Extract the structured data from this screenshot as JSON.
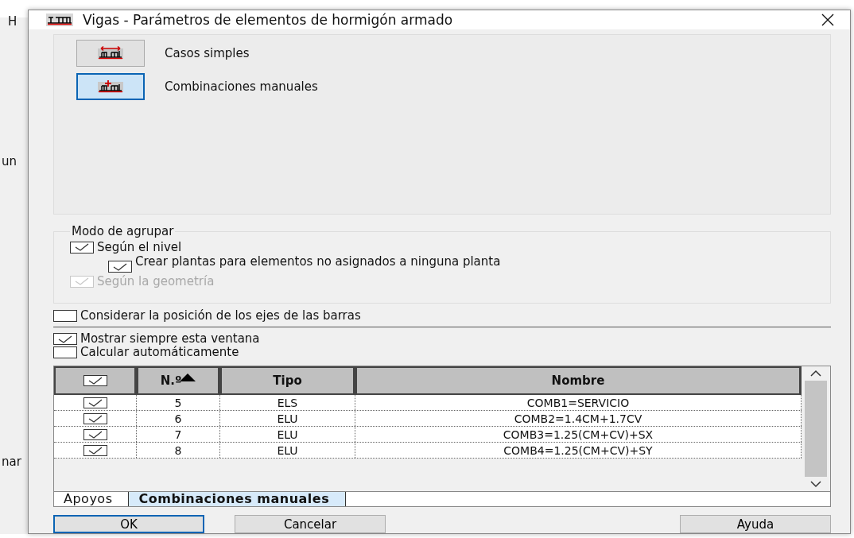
{
  "background_fragments": [
    "H",
    "un",
    "nar"
  ],
  "window": {
    "title": "Vigas - Parámetros de elementos de hormigón armado"
  },
  "modes": [
    {
      "label": "Casos simples",
      "selected": false,
      "kind": "simple"
    },
    {
      "label": "Combinaciones manuales",
      "selected": true,
      "kind": "manual"
    }
  ],
  "grouping": {
    "title": "Modo de agrupar",
    "options": [
      {
        "label": "Según el nivel",
        "checked": true,
        "disabled": false,
        "children": [
          {
            "label": "Crear plantas para elementos no asignados a ninguna planta",
            "checked": true,
            "disabled": false
          }
        ]
      },
      {
        "label": "Según la geometría",
        "checked": true,
        "disabled": true
      }
    ]
  },
  "axes_option": {
    "label": "Considerar la posición de los ejes de las barras",
    "checked": false
  },
  "options": [
    {
      "label": "Mostrar siempre esta ventana",
      "checked": true
    },
    {
      "label": "Calcular automáticamente",
      "checked": false
    }
  ],
  "table": {
    "header_checked": true,
    "columns": [
      "N.º",
      "Tipo",
      "Nombre"
    ],
    "rows": [
      {
        "checked": true,
        "cells": [
          "5",
          "ELS",
          "COMB1=SERVICIO"
        ]
      },
      {
        "checked": true,
        "cells": [
          "6",
          "ELU",
          "COMB2=1.4CM+1.7CV"
        ]
      },
      {
        "checked": true,
        "cells": [
          "7",
          "ELU",
          "COMB3=1.25(CM+CV)+SX"
        ]
      },
      {
        "checked": true,
        "cells": [
          "8",
          "ELU",
          "COMB4=1.25(CM+CV)+SY"
        ]
      }
    ]
  },
  "tabs": [
    {
      "label": "Apoyos",
      "selected": false
    },
    {
      "label": "Combinaciones manuales",
      "selected": true
    }
  ],
  "buttons": [
    {
      "label": "OK",
      "default": true
    },
    {
      "label": "Cancelar",
      "default": false
    },
    {
      "label": "Ayuda",
      "default": false
    }
  ]
}
